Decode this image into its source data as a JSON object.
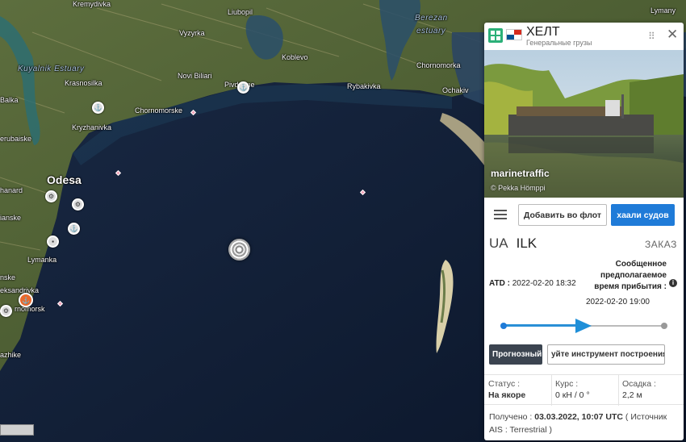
{
  "map": {
    "places": [
      {
        "name": "Kremydivka",
        "kind": "town"
      },
      {
        "name": "Liubopil",
        "kind": "town"
      },
      {
        "name": "Lymany",
        "kind": "town"
      },
      {
        "name": "Berezan",
        "kind": "water"
      },
      {
        "name": "estuary",
        "kind": "water"
      },
      {
        "name": "Kuyalnik Estuary",
        "kind": "water"
      },
      {
        "name": "Vyzyrka",
        "kind": "town"
      },
      {
        "name": "Koblevo",
        "kind": "town"
      },
      {
        "name": "Chornomorka",
        "kind": "town"
      },
      {
        "name": "Krasnosilka",
        "kind": "town"
      },
      {
        "name": "Novi Biliari",
        "kind": "town"
      },
      {
        "name": "Pivdenne",
        "kind": "town"
      },
      {
        "name": "Rybakivka",
        "kind": "town"
      },
      {
        "name": "Ochakiv",
        "kind": "town"
      },
      {
        "name": "Balka",
        "kind": "town"
      },
      {
        "name": "Chornomorske",
        "kind": "town"
      },
      {
        "name": "Kryzhanivka",
        "kind": "town"
      },
      {
        "name": "erubaiske",
        "kind": "town"
      },
      {
        "name": "Odesa",
        "kind": "city"
      },
      {
        "name": "hanard",
        "kind": "town"
      },
      {
        "name": "ianske",
        "kind": "town"
      },
      {
        "name": "Lymanka",
        "kind": "town"
      },
      {
        "name": "nske",
        "kind": "town"
      },
      {
        "name": "eksandrivka",
        "kind": "town"
      },
      {
        "name": "rnomorsk",
        "kind": "town"
      },
      {
        "name": "azhike",
        "kind": "town"
      }
    ]
  },
  "vessel": {
    "name": "ХЕЛТ",
    "type": "Генеральные грузы",
    "flag_colors": [
      "#d52b1e",
      "#ffffff",
      "#005293"
    ],
    "type_icon_color": "#2bb078",
    "photo": {
      "logo": "marinetraffic",
      "credit": "© Pekka Hömppi"
    },
    "actions": {
      "menu_icon": "hamburger-menu-icon",
      "add_to_fleet": "Добавить во флот",
      "ships": "хаали судов"
    },
    "route": {
      "from": "UA",
      "to": "ILK",
      "order": "ЗАКАЗ"
    },
    "atd": {
      "label": "ATD :",
      "value": "2022-02-20 18:32"
    },
    "eta": {
      "label_line1": "Сообщенное",
      "label_line2": "предполагаемое",
      "label_line3": "время прибытия :",
      "value": "2022-02-20 19:00",
      "info_icon": "i"
    },
    "progress": 0.5,
    "forecast_button": "Прогнозный",
    "tool_button": "уйте инструмент построения марш",
    "status": {
      "status_label": "Статус :",
      "status_value": "На якоре",
      "course_label": "Курс :",
      "course_value": "0 кН / 0 °",
      "draught_label": "Осадка :",
      "draught_value": "2,2 м"
    },
    "received": {
      "label": "Получено :",
      "value": "03.03.2022, 10:07 UTC",
      "source_open": "( Источник",
      "source_value": "AIS : Terrestrial )"
    },
    "accent_color": "#1f7bd8"
  }
}
